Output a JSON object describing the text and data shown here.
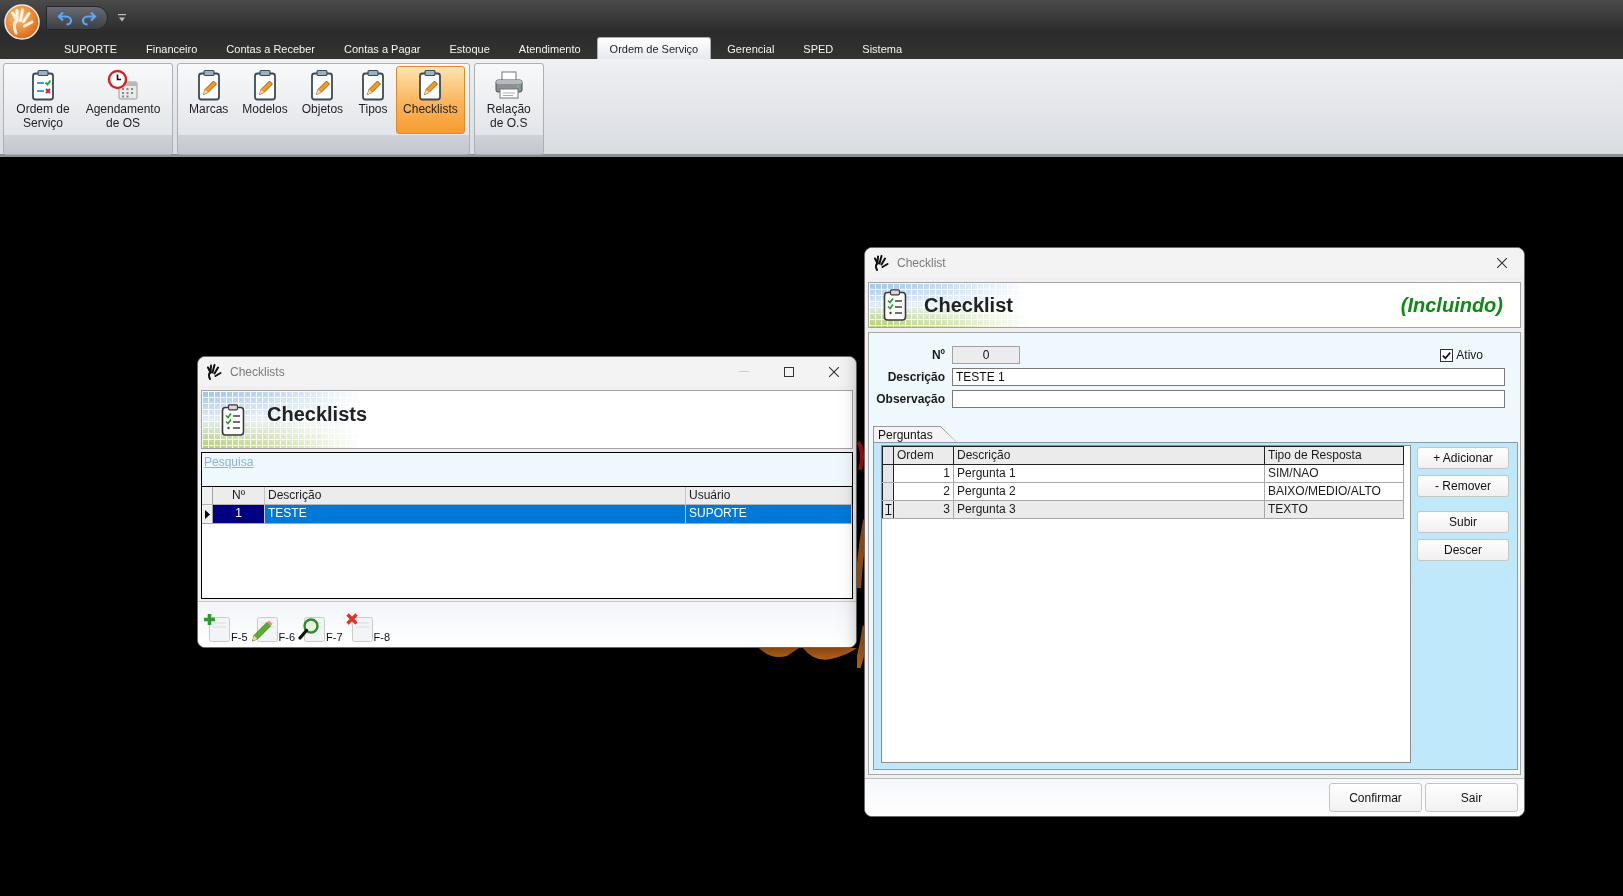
{
  "ribbon": {
    "tabs": [
      {
        "label": "SUPORTE",
        "selected": false
      },
      {
        "label": "Financeiro",
        "selected": false
      },
      {
        "label": "Contas a Receber",
        "selected": false
      },
      {
        "label": "Contas a Pagar",
        "selected": false
      },
      {
        "label": "Estoque",
        "selected": false
      },
      {
        "label": "Atendimento",
        "selected": false
      },
      {
        "label": "Ordem de Serviço",
        "selected": true
      },
      {
        "label": "Gerencial",
        "selected": false
      },
      {
        "label": "SPED",
        "selected": false
      },
      {
        "label": "Sistema",
        "selected": false
      }
    ],
    "groups": [
      {
        "buttons": [
          {
            "kind": "order",
            "label": "Ordem de Serviço",
            "selected": false
          },
          {
            "kind": "schedule",
            "label": "Agendamento de OS",
            "selected": false
          }
        ]
      },
      {
        "buttons": [
          {
            "kind": "edit",
            "label": "Marcas",
            "selected": false
          },
          {
            "kind": "edit",
            "label": "Modelos",
            "selected": false
          },
          {
            "kind": "edit",
            "label": "Objetos",
            "selected": false
          },
          {
            "kind": "edit",
            "label": "Tipos",
            "selected": false
          },
          {
            "kind": "edit",
            "label": "Checklists",
            "selected": true
          }
        ]
      },
      {
        "buttons": [
          {
            "kind": "print",
            "label": "Relação de O.S",
            "selected": false
          }
        ]
      }
    ]
  },
  "checklists_window": {
    "title": "Checklists",
    "controls": [
      {
        "kind": "minimize",
        "disabled": true
      },
      {
        "kind": "maximize",
        "disabled": false
      },
      {
        "kind": "close",
        "disabled": false
      }
    ],
    "header": "Checklists",
    "search_link": "Pesquisa",
    "table": {
      "columns": [
        "Nº",
        "Descrição",
        "Usuário"
      ],
      "rows": [
        {
          "cells": [
            "1",
            "TESTE",
            "SUPORTE"
          ],
          "selected": true
        }
      ]
    },
    "toolbar": [
      {
        "kind": "add",
        "shortcut": "F-5"
      },
      {
        "kind": "edit",
        "shortcut": "F-6"
      },
      {
        "kind": "search",
        "shortcut": "F-7"
      },
      {
        "kind": "delete",
        "shortcut": "F-8"
      }
    ]
  },
  "checklist_window": {
    "title": "Checklist",
    "controls": [
      {
        "kind": "close",
        "disabled": false
      }
    ],
    "header": "Checklist",
    "mode": "(Incluindo)",
    "fields": [
      {
        "label": "Nº",
        "value": "0",
        "readonly": true
      },
      {
        "label": "Descrição",
        "value": "TESTE 1",
        "readonly": false
      },
      {
        "label": "Observação",
        "readonly": false
      }
    ],
    "active": {
      "label": "Ativo",
      "checked": true
    },
    "tabs": [
      {
        "label": "Perguntas",
        "selected": true
      }
    ],
    "questions_table": {
      "columns": [
        "Ordem",
        "Descrição",
        "Tipo de Resposta"
      ],
      "rows": [
        {
          "cells": [
            "1",
            "Pergunta 1",
            "SIM/NAO"
          ],
          "selected": false
        },
        {
          "cells": [
            "2",
            "Pergunta 2",
            "BAIXO/MEDIO/ALTO"
          ],
          "selected": false
        },
        {
          "cells": [
            "3",
            "Pergunta 3",
            "TEXTO"
          ],
          "selected": true
        }
      ]
    },
    "side_buttons": [
      "+ Adicionar",
      "- Remover",
      "Subir",
      "Descer"
    ],
    "footer_buttons": [
      "Confirmar",
      "Sair"
    ]
  }
}
